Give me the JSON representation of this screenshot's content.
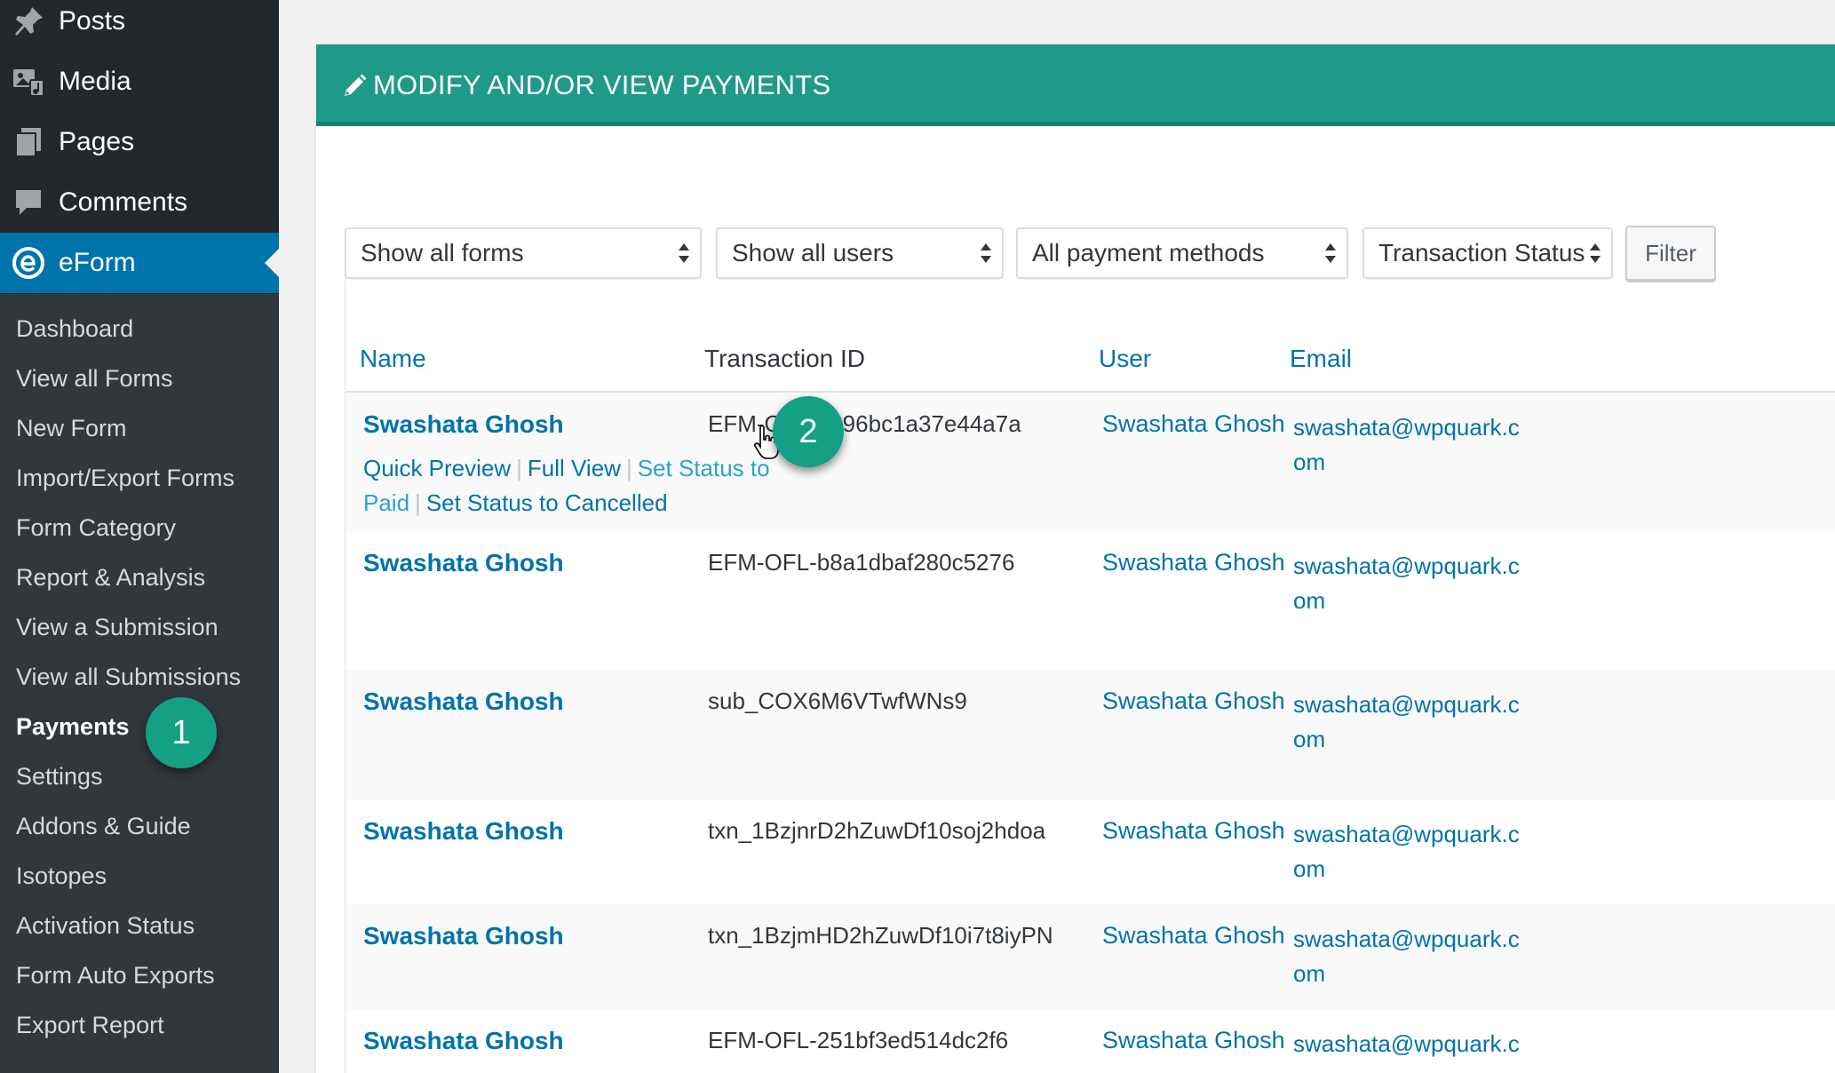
{
  "sidebar": {
    "menu": [
      {
        "label": "Posts",
        "icon": "pin-icon"
      },
      {
        "label": "Media",
        "icon": "media-icon"
      },
      {
        "label": "Pages",
        "icon": "pages-icon"
      },
      {
        "label": "Comments",
        "icon": "comment-icon"
      },
      {
        "label": "eForm",
        "icon": "eform-icon"
      }
    ],
    "submenu": [
      "Dashboard",
      "View all Forms",
      "New Form",
      "Import/Export Forms",
      "Form Category",
      "Report & Analysis",
      "View a Submission",
      "View all Submissions",
      "Payments",
      "Settings",
      "Addons & Guide",
      "Isotopes",
      "Activation Status",
      "Form Auto Exports",
      "Export Report"
    ],
    "current_submenu": "Payments"
  },
  "badges": {
    "one": "1",
    "two": "2"
  },
  "panel": {
    "title": "MODIFY AND/OR VIEW PAYMENTS",
    "filters": {
      "forms": "Show all forms",
      "users": "Show all users",
      "methods": "All payment methods",
      "status": "Transaction Status",
      "button": "Filter"
    },
    "columns": {
      "name": "Name",
      "txn": "Transaction ID",
      "user": "User",
      "email": "Email"
    },
    "rows": [
      {
        "name": "Swashata Ghosh",
        "txn": "EFM-OFL-2896bc1a37e44a7a",
        "user": "Swashata Ghosh",
        "email": "swashata@wpquark.com"
      },
      {
        "name": "Swashata Ghosh",
        "txn": "EFM-OFL-b8a1dbaf280c5276",
        "user": "Swashata Ghosh",
        "email": "swashata@wpquark.com"
      },
      {
        "name": "Swashata Ghosh",
        "txn": "sub_COX6M6VTwfWNs9",
        "user": "Swashata Ghosh",
        "email": "swashata@wpquark.com"
      },
      {
        "name": "Swashata Ghosh",
        "txn": "txn_1BzjnrD2hZuwDf10soj2hdoa",
        "user": "Swashata Ghosh",
        "email": "swashata@wpquark.com"
      },
      {
        "name": "Swashata Ghosh",
        "txn": "txn_1BzjmHD2hZuwDf10i7t8iyPN",
        "user": "Swashata Ghosh",
        "email": "swashata@wpquark.com"
      },
      {
        "name": "Swashata Ghosh",
        "txn": "EFM-OFL-251bf3ed514dc2f6",
        "user": "Swashata Ghosh",
        "email": "swashata@wpquark.com"
      }
    ],
    "row_actions": {
      "quick_preview": "Quick Preview",
      "full_view": "Full View",
      "set_paid": "Set Status to Paid",
      "set_cancelled": "Set Status to Cancelled"
    }
  },
  "colors": {
    "sidebar_bg": "#23282d",
    "submenu_bg": "#32373c",
    "active_menu": "#0073aa",
    "header_teal": "#1f998a",
    "badge_green": "#14a085",
    "link_blue": "#0073aa"
  }
}
